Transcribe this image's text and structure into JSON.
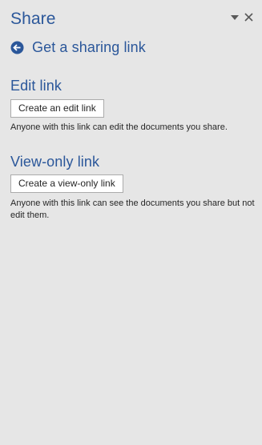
{
  "pane": {
    "title": "Share",
    "menu_icon": "dropdown-triangle-icon",
    "close_icon": "close-icon"
  },
  "back": {
    "icon": "back-arrow-circle-icon",
    "label": "Get a sharing link"
  },
  "edit_section": {
    "title": "Edit link",
    "button_label": "Create an edit link",
    "description": "Anyone with this link can edit the documents you share."
  },
  "view_section": {
    "title": "View-only link",
    "button_label": "Create a view-only link",
    "description": "Anyone with this link can see the documents you share but not edit them."
  },
  "colors": {
    "accent": "#2b579a",
    "background": "#e6e6e6",
    "text": "#262626"
  }
}
